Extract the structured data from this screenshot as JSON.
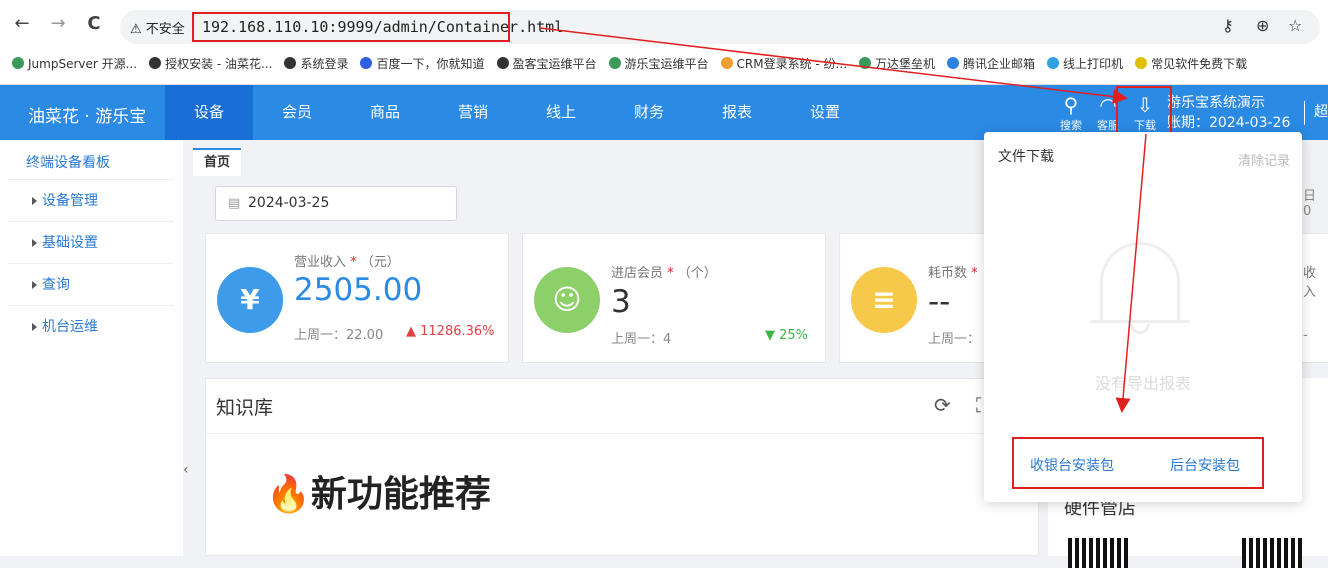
{
  "browser": {
    "back": "←",
    "forward": "→",
    "reload": "C",
    "insecure_label": "⚠ 不安全",
    "url": "192.168.110.10:9999/admin/Container.html",
    "key_icon": "key-icon",
    "zoom_icon": "zoom-icon",
    "star_icon": "star-icon"
  },
  "bookmarks": [
    {
      "label": "JumpServer 开源...",
      "color": "#3a9a5a"
    },
    {
      "label": "授权安装 - 油菜花...",
      "color": "#333"
    },
    {
      "label": "系统登录",
      "color": "#333"
    },
    {
      "label": "百度一下，你就知道",
      "color": "#3060e0"
    },
    {
      "label": "盈客宝运维平台",
      "color": "#333"
    },
    {
      "label": "游乐宝运维平台",
      "color": "#3a9a5a"
    },
    {
      "label": "CRM登录系统 - 纷...",
      "color": "#f0a030"
    },
    {
      "label": "万达堡垒机",
      "color": "#3a9a5a"
    },
    {
      "label": "腾讯企业邮箱",
      "color": "#3080e0"
    },
    {
      "label": "线上打印机",
      "color": "#30a0e0"
    },
    {
      "label": "常见软件免费下载",
      "color": "#e0c000"
    }
  ],
  "topbar": {
    "brand": "油菜花 · 游乐宝",
    "menu": [
      "设备",
      "会员",
      "商品",
      "营销",
      "线上",
      "财务",
      "报表",
      "设置"
    ],
    "active_menu": "设备",
    "search_label": "搜索",
    "service_label": "客服",
    "download_label": "下载",
    "account_name": "游乐宝系统演示",
    "account_expiry": "账期：2024-03-26",
    "account_extra": "超"
  },
  "sidebar": {
    "title": "终端设备看板",
    "items": [
      "设备管理",
      "基础设置",
      "查询",
      "机台运维"
    ],
    "collapse": "‹"
  },
  "tab": "首页",
  "date_value": "2024-03-25",
  "right_hint": "日 0",
  "cards": [
    {
      "label": "营业收入",
      "unit": "（元）",
      "value": "2505.00",
      "sub": "上周一：22.00",
      "change": "▲ 11286.36%",
      "icon": "¥",
      "color": "#3d9be9"
    },
    {
      "label": "进店会员",
      "unit": "（个）",
      "value": "3",
      "sub": "上周一：4",
      "change": "▼ 25%",
      "icon": "👥",
      "color": "#8dd06a"
    },
    {
      "label": "耗币数",
      "unit": "",
      "value": "--",
      "sub": "上周一：",
      "change": "",
      "icon": "≡",
      "color": "#f7c94a"
    }
  ],
  "req_mark": "*",
  "partial_card": {
    "label": "收入",
    "dash": "-"
  },
  "knowledge": {
    "title": "知识库",
    "feature": "🔥新功能推荐"
  },
  "right_panel": {
    "title": "硬件管店"
  },
  "popup": {
    "title": "文件下载",
    "clear": "清除记录",
    "empty": "没有导出报表",
    "btn_cashier": "收银台安装包",
    "btn_backend": "后台安装包"
  }
}
